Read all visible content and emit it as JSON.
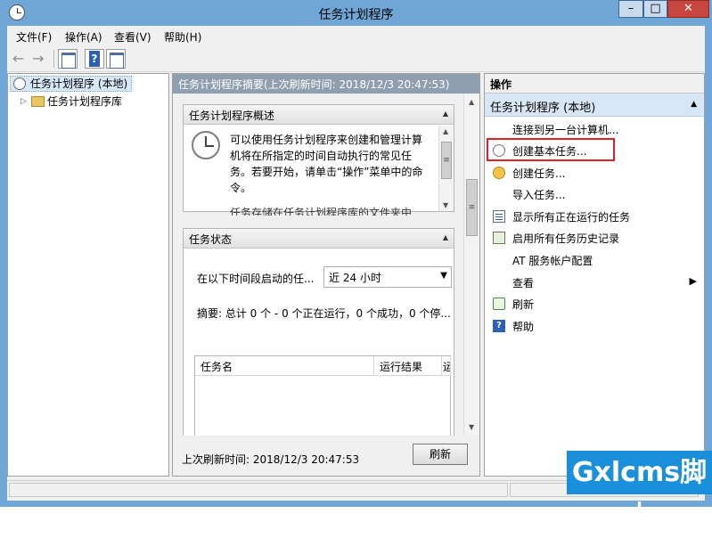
{
  "window": {
    "title": "任务计划程序",
    "min_label": "–",
    "max_label": "□",
    "close_label": "✕"
  },
  "menu": {
    "items": [
      "文件(F)",
      "操作(A)",
      "查看(V)",
      "帮助(H)"
    ]
  },
  "toolbar": {
    "back_icon": "←",
    "forward_icon": "→"
  },
  "tree": {
    "root_label": "任务计划程序 (本地)",
    "child_label": "任务计划程序库"
  },
  "center": {
    "header": "任务计划程序摘要(上次刷新时间: 2018/12/3 20:47:53)",
    "overview_title": "任务计划程序概述",
    "overview_text": "可以使用任务计划程序来创建和管理计算机将在所指定的时间自动执行的常见任务。若要开始，请单击“操作”菜单中的命令。",
    "overview_text_cut": "任务存储在任务计划程序库的文件夹中",
    "status_title": "任务状态",
    "status_label": "在以下时间段启动的任...",
    "status_selected": "近 24 小时",
    "status_summary": "摘要: 总计 0 个 - 0 个正在运行，0 个成功，0 个停...",
    "table_headers": [
      "任务名",
      "运行结果",
      "运"
    ],
    "last_refresh": "上次刷新时间: 2018/12/3 20:47:53",
    "refresh_button": "刷新"
  },
  "actions": {
    "header": "操作",
    "section": "任务计划程序 (本地)",
    "items": [
      {
        "label": "连接到另一台计算机..."
      },
      {
        "label": "创建基本任务..."
      },
      {
        "label": "创建任务..."
      },
      {
        "label": "导入任务..."
      },
      {
        "label": "显示所有正在运行的任务"
      },
      {
        "label": "启用所有任务历史记录"
      },
      {
        "label": "AT 服务帐户配置"
      },
      {
        "label": "查看"
      },
      {
        "label": "刷新"
      },
      {
        "label": "帮助"
      }
    ],
    "highlighted_index": 1,
    "highlight_color": "#d9202c"
  },
  "watermark": "Gxlcms脚本"
}
